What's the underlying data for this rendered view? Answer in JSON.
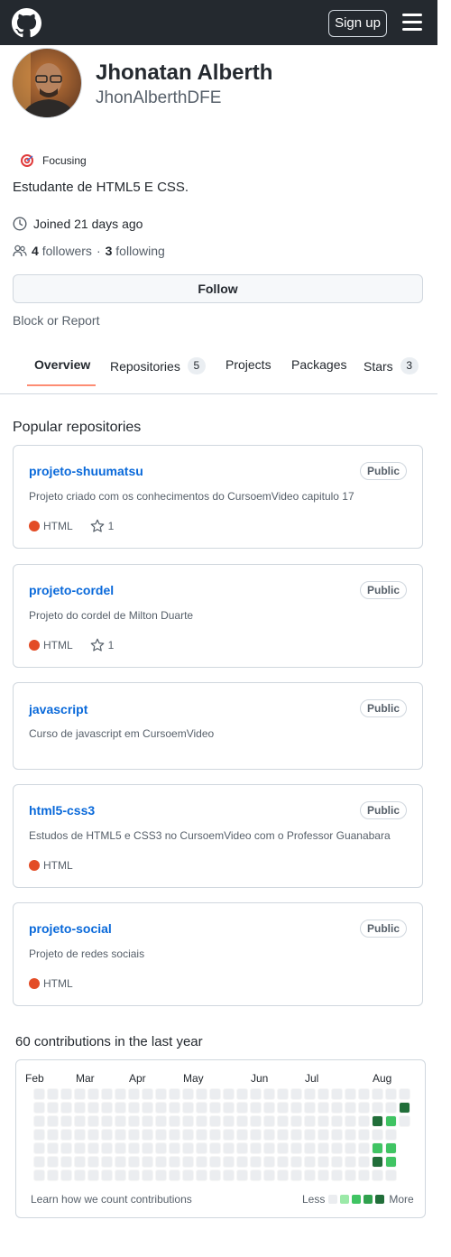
{
  "header": {
    "logo_icon": "github-logo-icon",
    "signup_label": "Sign up",
    "menu_icon": "hamburger-menu-icon"
  },
  "profile": {
    "name": "Jhonatan Alberth",
    "login": "JhonAlberthDFE",
    "status_icon": "target-emoji-icon",
    "status": "Focusing",
    "bio": "Estudante de HTML5 E CSS.",
    "joined": "Joined 21 days ago",
    "followers_count": "4",
    "followers_label": "followers",
    "separator": "·",
    "following_count": "3",
    "following_label": "following",
    "follow_label": "Follow",
    "block_label": "Block or Report"
  },
  "tabs": [
    {
      "label": "Overview",
      "count": null,
      "selected": true
    },
    {
      "label": "Repositories",
      "count": "5"
    },
    {
      "label": "Projects",
      "count": null
    },
    {
      "label": "Packages",
      "count": null
    },
    {
      "label": "Stars",
      "count": "3"
    }
  ],
  "popular": {
    "title": "Popular repositories",
    "repos": [
      {
        "name": "projeto-shuumatsu",
        "visibility": "Public",
        "description": "Projeto criado com os conhecimentos do CursoemVideo capitulo 17",
        "language": "HTML",
        "stars": "1"
      },
      {
        "name": "projeto-cordel",
        "visibility": "Public",
        "description": "Projeto do cordel de Milton Duarte",
        "language": "HTML",
        "stars": "1"
      },
      {
        "name": "javascript",
        "visibility": "Public",
        "description": "Curso de javascript em CursoemVideo",
        "language": "",
        "stars": ""
      },
      {
        "name": "html5-css3",
        "visibility": "Public",
        "description": "Estudos de HTML5 e CSS3 no CursoemVideo com o Professor Guanabara",
        "language": "HTML",
        "stars": ""
      },
      {
        "name": "projeto-social",
        "visibility": "Public",
        "description": "Projeto de redes sociais",
        "language": "HTML",
        "stars": ""
      }
    ],
    "language_color": "#e34c26"
  },
  "contributions": {
    "title": "60 contributions in the last year",
    "months": [
      "Feb",
      "Mar",
      "Apr",
      "May",
      "Jun",
      "Jul",
      "Aug"
    ],
    "active_cells": [
      {
        "week": 27,
        "day": 1,
        "level": 4
      },
      {
        "week": 25,
        "day": 2,
        "level": 4
      },
      {
        "week": 26,
        "day": 2,
        "level": 2
      },
      {
        "week": 27,
        "day": 2,
        "level": 0
      },
      {
        "week": 25,
        "day": 4,
        "level": 2
      },
      {
        "week": 26,
        "day": 4,
        "level": 2
      },
      {
        "week": 25,
        "day": 5,
        "level": 4
      },
      {
        "week": 26,
        "day": 5,
        "level": 2
      }
    ],
    "learn_label": "Learn how we count contributions",
    "less_label": "Less",
    "more_label": "More",
    "level_colors": [
      "#ebedf0",
      "#9be9a8",
      "#40c463",
      "#30a14e",
      "#216e39"
    ]
  }
}
